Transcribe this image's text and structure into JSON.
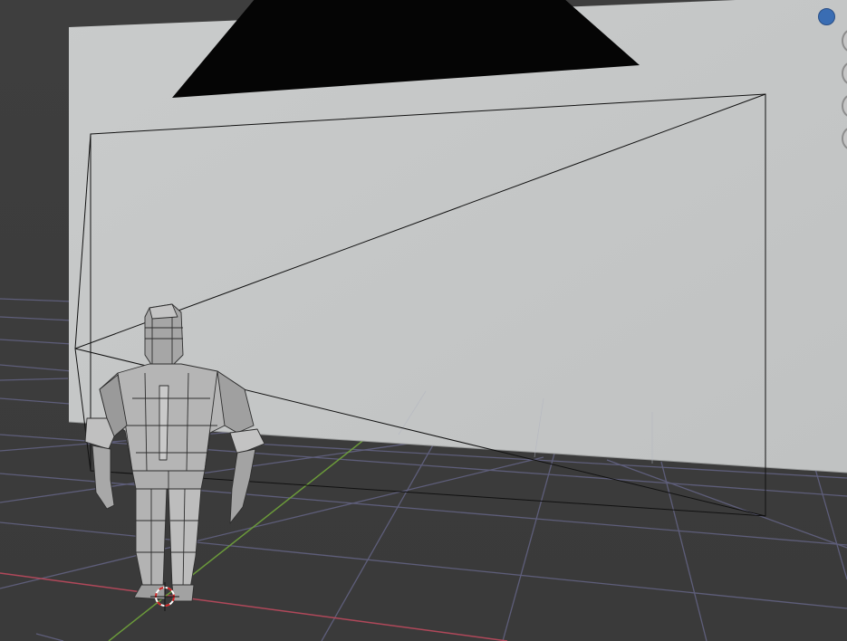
{
  "app": "3D Viewport",
  "colors": {
    "background": "#3d3d3d",
    "grid": "#5f5f7d",
    "x_axis": "#b0485a",
    "y_axis": "#6b9a3a",
    "wall": "#c4c6c6",
    "camera_frame": "#111111",
    "cursor_red": "#d02020"
  },
  "scene": {
    "objects": [
      "backdrop-wall",
      "camera",
      "area-light",
      "character-mesh",
      "3d-cursor"
    ]
  },
  "navigation_gizmo": {
    "buttons": [
      "view-toggle",
      "zoom",
      "pan",
      "camera-view",
      "perspective-toggle"
    ]
  }
}
